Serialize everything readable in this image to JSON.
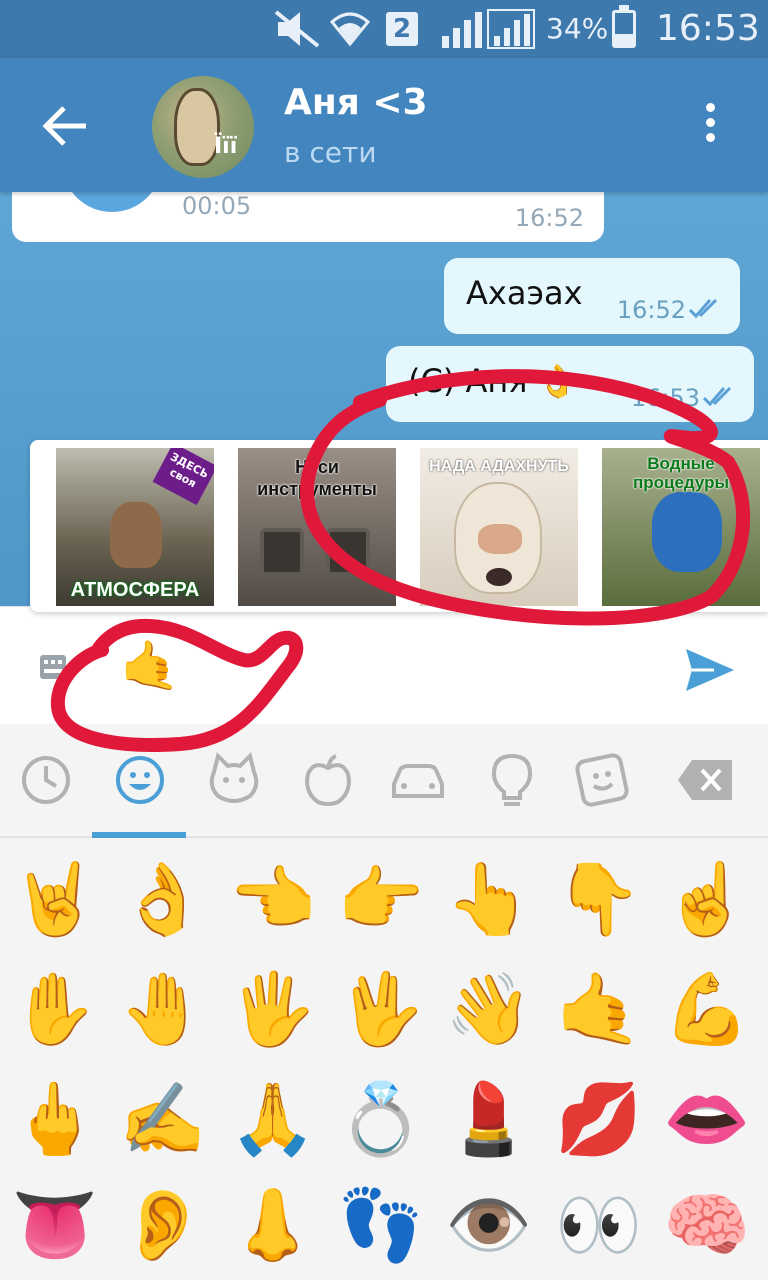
{
  "status_bar": {
    "battery": "34%",
    "sim": "2",
    "time": "16:53",
    "icons": [
      "mute-icon",
      "wifi-icon",
      "signal-icon",
      "battery-icon"
    ]
  },
  "header": {
    "name": "Аня <3",
    "status": "в сети",
    "back_icon": "arrow-left-icon",
    "menu_icon": "more-vertical-icon",
    "avatar_mark": "Ïïï"
  },
  "messages": [
    {
      "direction": "in",
      "type": "voice",
      "duration": "00:05",
      "time": "16:52"
    },
    {
      "direction": "out",
      "text": "Ахаэах",
      "time": "16:52",
      "read": true
    },
    {
      "direction": "out",
      "text": "(С) Аня 👌",
      "time": "16:53",
      "read": true
    }
  ],
  "sticker_suggestions": [
    {
      "caption": "АТМОСФЕРА",
      "badge": "ЗДЕСЬ своя"
    },
    {
      "caption": "Неси инструменты"
    },
    {
      "caption": "НАДА АДАХНУТЬ"
    },
    {
      "caption": "Водные процедуры"
    }
  ],
  "input": {
    "value": "🤙",
    "keyboard_icon": "keyboard-icon",
    "send_icon": "send-icon"
  },
  "emoji_tabs": [
    {
      "name": "recent-icon",
      "active": false
    },
    {
      "name": "smile-icon",
      "active": true
    },
    {
      "name": "cat-icon",
      "active": false
    },
    {
      "name": "apple-icon",
      "active": false
    },
    {
      "name": "car-icon",
      "active": false
    },
    {
      "name": "lightbulb-icon",
      "active": false
    },
    {
      "name": "symbols-icon",
      "active": false
    },
    {
      "name": "backspace-icon",
      "active": false
    }
  ],
  "emoji_grid": [
    [
      "🤘",
      "👌",
      "👈",
      "👉",
      "👆",
      "👇",
      "☝️"
    ],
    [
      "✋",
      "🤚",
      "🖐️",
      "🖖",
      "👋",
      "🤙",
      "💪"
    ],
    [
      "🖕",
      "✍️",
      "🙏",
      "💍",
      "💄",
      "💋",
      "👄"
    ],
    [
      "👅",
      "👂",
      "👃",
      "👣",
      "👁️",
      "👀",
      "🧠"
    ]
  ],
  "colors": {
    "header": "#4386bf",
    "status_bar": "#3d79ad",
    "chat_bg": "#5ea6d5",
    "out_bubble": "#e3f7fd",
    "accent": "#4a9fd6",
    "annotation": "#e0193a"
  }
}
